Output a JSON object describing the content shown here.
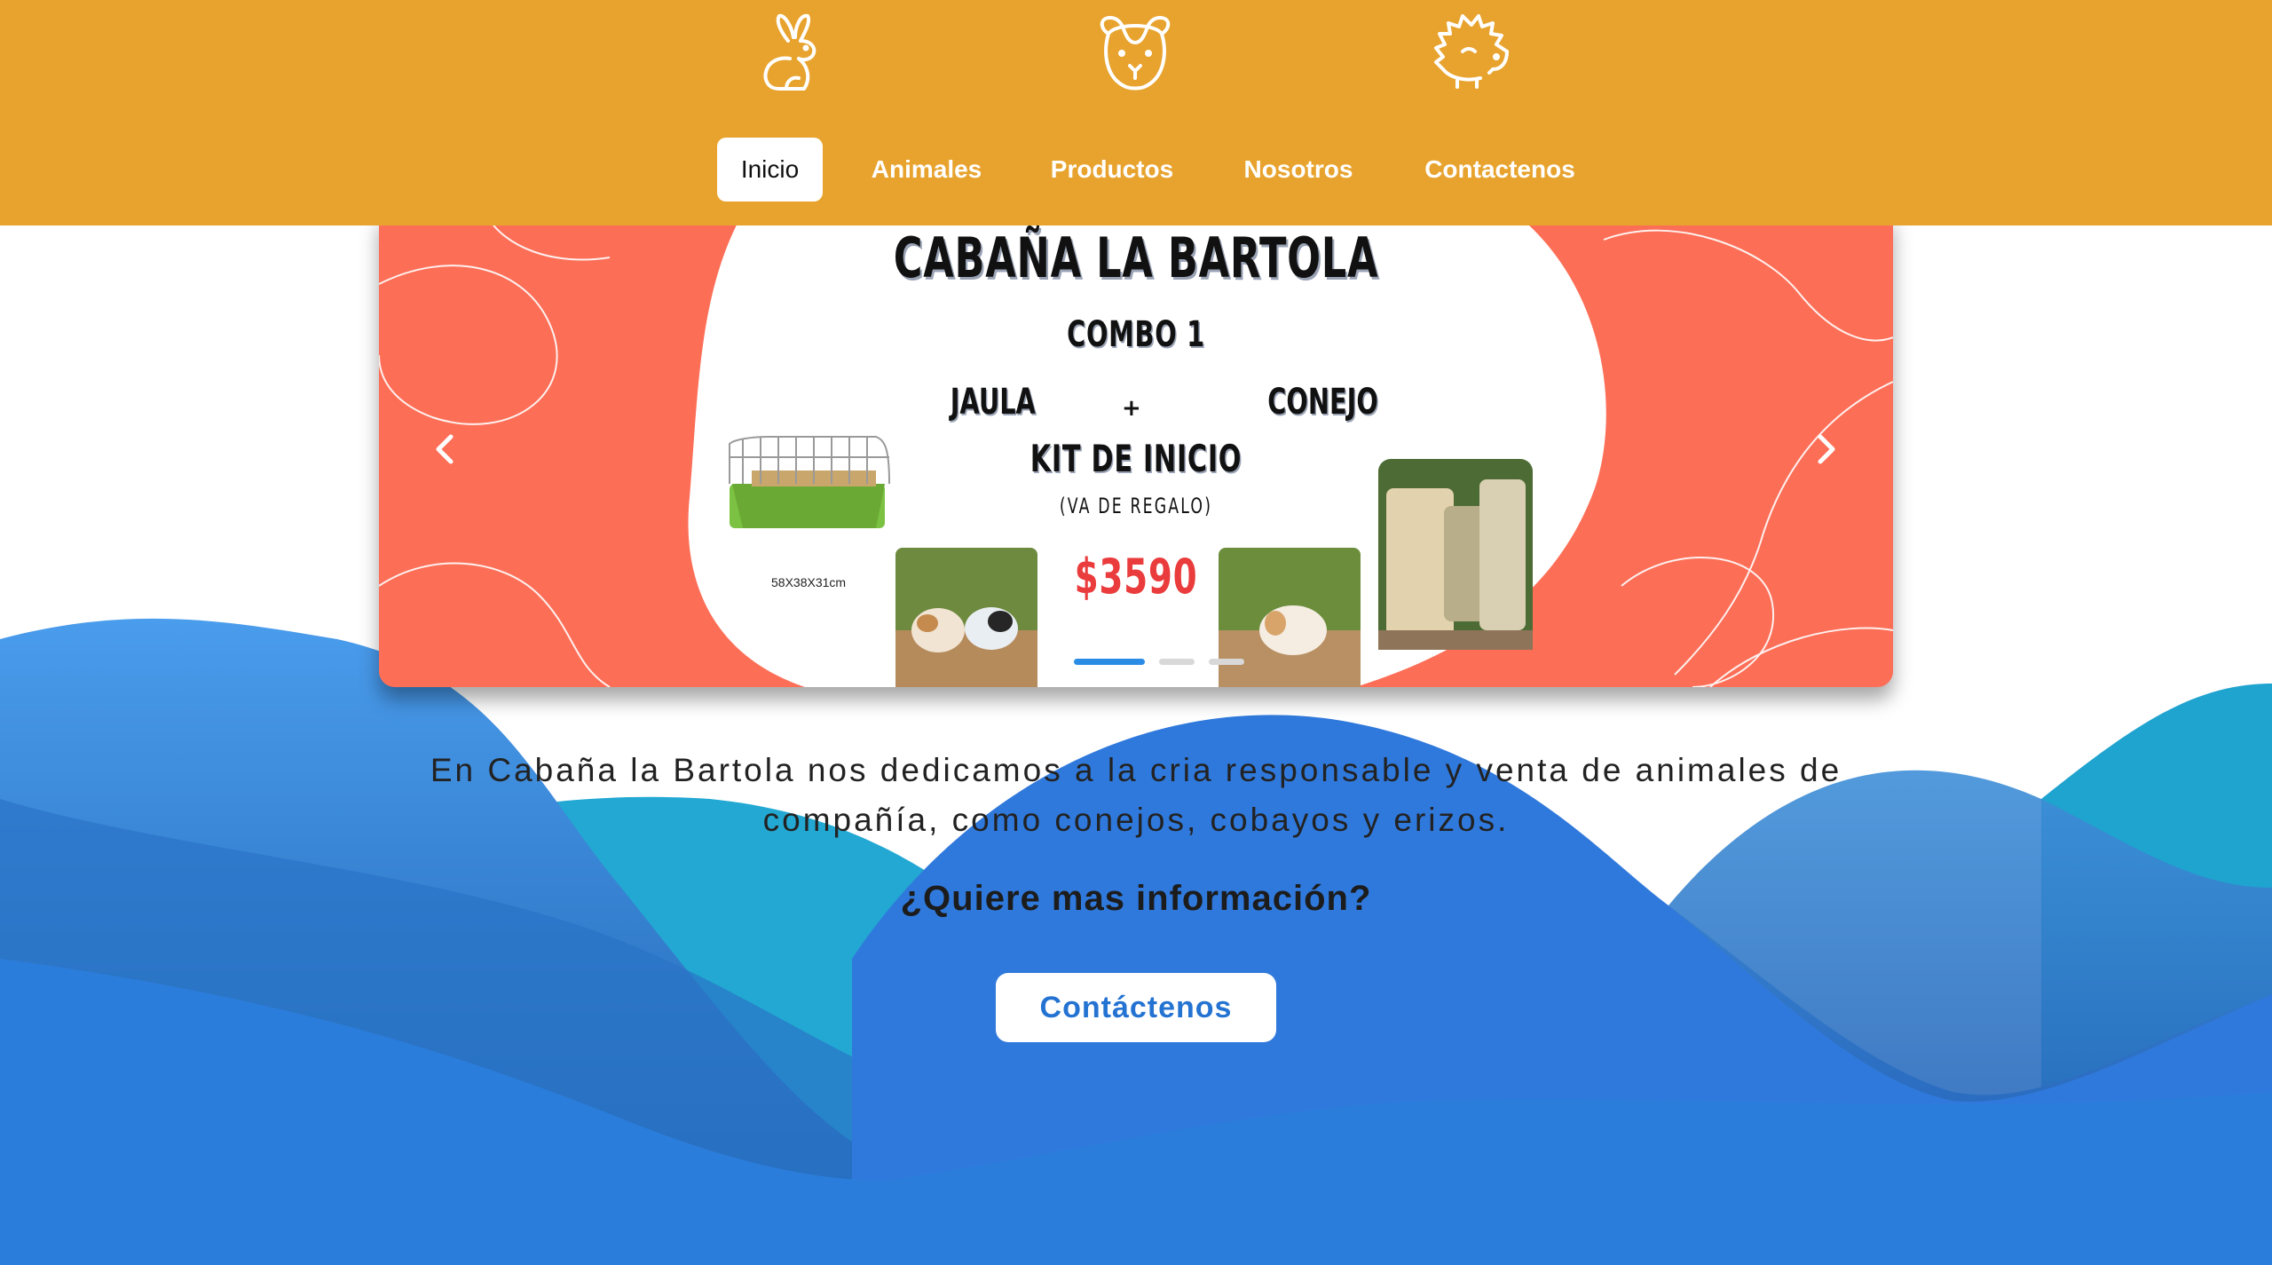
{
  "header": {
    "icons": [
      "rabbit-icon",
      "guinea-pig-icon",
      "hedgehog-icon"
    ],
    "nav": [
      {
        "label": "Inicio",
        "active": true
      },
      {
        "label": "Animales",
        "active": false
      },
      {
        "label": "Productos",
        "active": false
      },
      {
        "label": "Nosotros",
        "active": false
      },
      {
        "label": "Contactenos",
        "active": false
      }
    ]
  },
  "carousel": {
    "slide": {
      "title": "CABAÑA LA BARTOLA",
      "combo": "COMBO 1",
      "left_item": "JAULA",
      "plus": "+",
      "right_item": "CONEJO",
      "kit": "KIT DE INICIO",
      "gift": "(VA DE REGALO)",
      "price": "$3590",
      "cage_size": "58X38X31cm"
    },
    "prev_icon": "chevron-left-icon",
    "next_icon": "chevron-right-icon",
    "indicator_count": 3,
    "active_indicator": 0
  },
  "main": {
    "intro": "En Cabaña la Bartola nos dedicamos a la cria responsable y venta de animales de compañía, como conejos, cobayos y erizos.",
    "question": "¿Quiere mas información?",
    "cta_label": "Contáctenos"
  },
  "colors": {
    "header_bg": "#e8a32e",
    "slide_bg": "#fd6e57",
    "wave_blue": "#2b7ddc",
    "wave_teal": "#21a8cf",
    "cta_text": "#2473d2"
  }
}
